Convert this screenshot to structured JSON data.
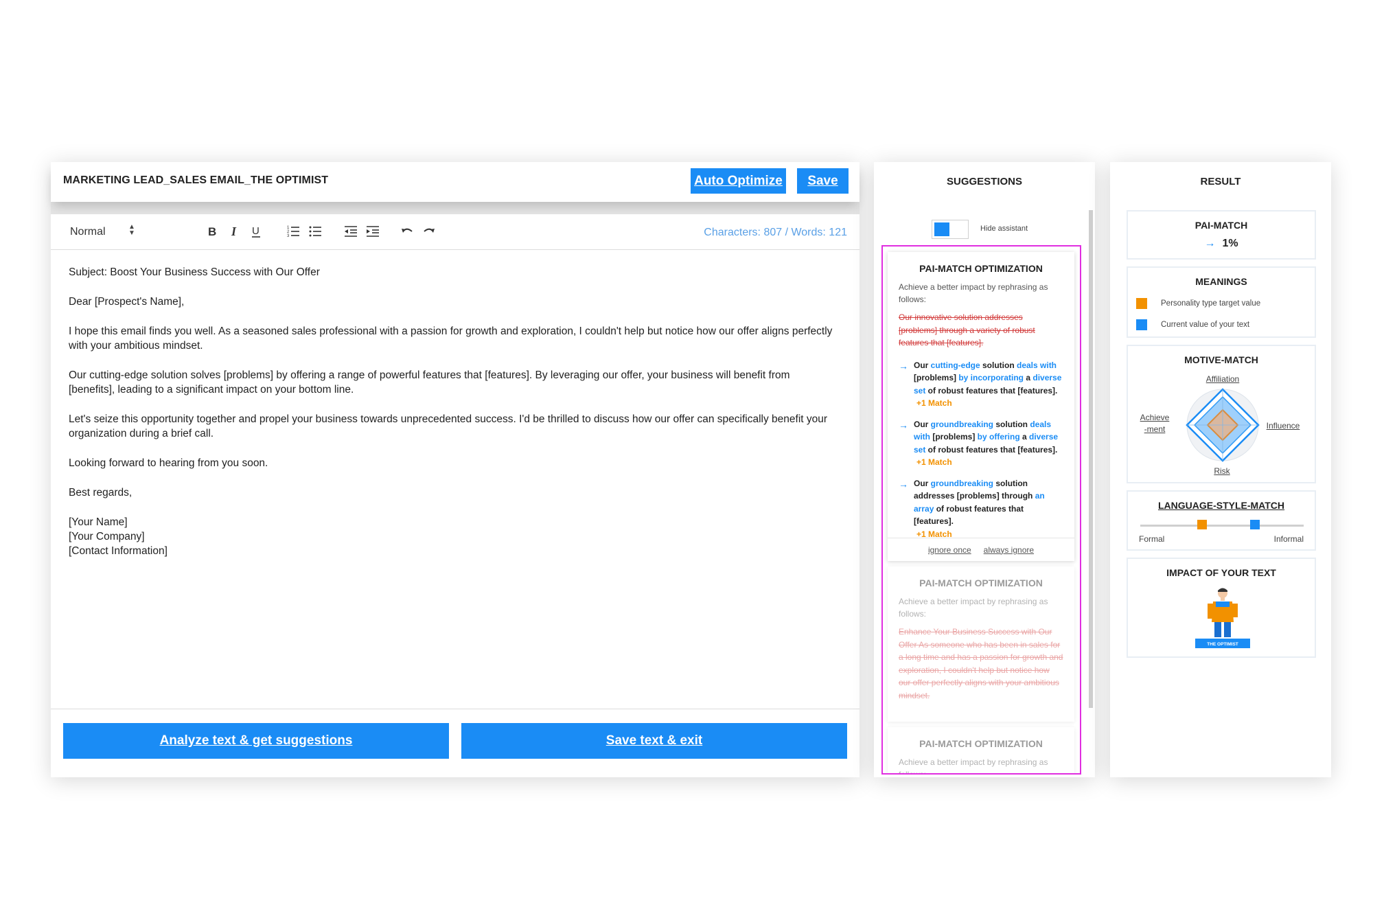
{
  "editor": {
    "title": "MARKETING LEAD_SALES EMAIL_THE OPTIMIST",
    "auto_optimize_label": "Auto Optimize",
    "save_label": "Save",
    "format_select": "Normal",
    "counts": "Characters: 807 / Words: 121",
    "body": {
      "subject": "Subject: Boost Your Business Success with Our Offer",
      "greeting": "Dear [Prospect's Name],",
      "p1": "I hope this email finds you well. As a seasoned sales professional with a passion for growth and exploration, I couldn't help but notice how our offer aligns perfectly with your ambitious mindset.",
      "p2": "Our cutting-edge solution solves [problems] by offering a range of powerful features that [features]. By leveraging our offer, your business will benefit from [benefits], leading to a significant impact on your bottom line.",
      "p3": "Let's seize this opportunity together and propel your business towards unprecedented success. I'd be thrilled to discuss how our offer can specifically benefit your organization during a brief call.",
      "p4": "Looking forward to hearing from you soon.",
      "closing": "Best regards,",
      "sig_name": "[Your Name]",
      "sig_company": "[Your Company]",
      "sig_contact": "[Contact Information]"
    },
    "analyze_label": "Analyze text & get suggestions",
    "save_exit_label": "Save text & exit"
  },
  "suggestions": {
    "title": "SUGGESTIONS",
    "hide_assistant_label": "Hide assistant",
    "cards": [
      {
        "title": "PAI-MATCH OPTIMIZATION",
        "intro": "Achieve a better impact by rephrasing as follows:",
        "original": "Our innovative solution addresses [problems] through a variety of robust features that [features].",
        "options": [
          {
            "parts": [
              "Our ",
              "cutting-edge",
              " solution ",
              "deals with",
              " [problems] ",
              "by incorporating",
              " a ",
              "diverse set",
              " of robust features that [features]."
            ],
            "match": "+1 Match"
          },
          {
            "parts": [
              "Our ",
              "groundbreaking",
              " solution ",
              "deals with",
              " [problems] ",
              "by offering",
              " a ",
              "diverse set",
              " of robust features that [features]."
            ],
            "match": "+1 Match"
          },
          {
            "parts": [
              "Our ",
              "groundbreaking",
              " solution addresses [problems] through ",
              "an array",
              " of robust features that [features].",
              "",
              "",
              "",
              ""
            ],
            "match": "+1 Match"
          }
        ],
        "ignore_once": "ignore once",
        "always_ignore": "always ignore"
      },
      {
        "title": "PAI-MATCH OPTIMIZATION",
        "intro": "Achieve a better impact by rephrasing as follows:",
        "original": "Enhance Your Business Success with Our Offer As someone who has been in sales for a long time and has a passion for growth and exploration, I couldn't help but notice how our offer perfectly aligns with your ambitious mindset."
      },
      {
        "title": "PAI-MATCH OPTIMIZATION",
        "intro": "Achieve a better impact by rephrasing as follows:"
      }
    ]
  },
  "result": {
    "title": "RESULT",
    "pai_match": {
      "title": "PAI-MATCH",
      "value": "1%"
    },
    "meanings": {
      "title": "MEANINGS",
      "target_label": "Personality type target value",
      "current_label": "Current value of your text",
      "target_color": "#f29100",
      "current_color": "#1a8cf5"
    },
    "motive_match": {
      "title": "MOTIVE-MATCH",
      "affiliation": "Affiliation",
      "influence": "Influence",
      "risk": "Risk",
      "achieve_line1": "Achieve",
      "achieve_line2": "-ment"
    },
    "language_style": {
      "title": "LANGUAGE-STYLE-MATCH",
      "formal": "Formal",
      "informal": "Informal",
      "target_position": 0.38,
      "current_position": 0.7
    },
    "impact": {
      "title": "IMPACT OF YOUR TEXT",
      "badge": "THE OPTIMIST"
    }
  }
}
